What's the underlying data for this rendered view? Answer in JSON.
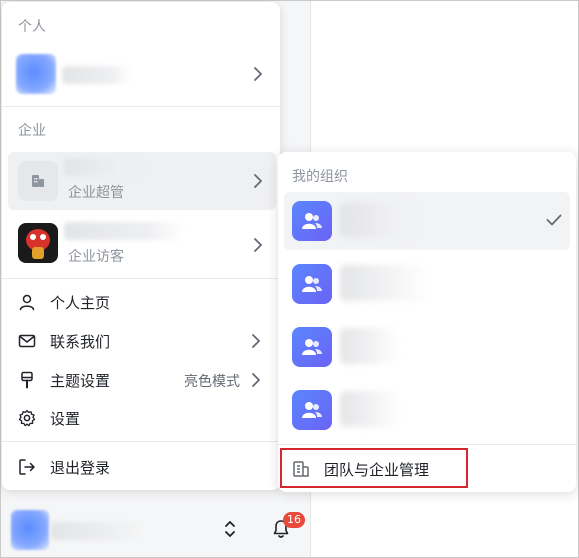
{
  "menu": {
    "personal_section": "个人",
    "enterprise_section": "企业",
    "enterprises": [
      {
        "role": "企业超管",
        "selected": true
      },
      {
        "role": "企业访客",
        "selected": false
      }
    ],
    "items": [
      {
        "label": "个人主页",
        "icon": "user-icon"
      },
      {
        "label": "联系我们",
        "icon": "mail-icon"
      },
      {
        "label": "主题设置",
        "icon": "brush-icon",
        "value": "亮色模式"
      },
      {
        "label": "设置",
        "icon": "gear-icon"
      }
    ],
    "logout_label": "退出登录"
  },
  "org_panel": {
    "title": "我的组织",
    "organizations": [
      {
        "selected": true,
        "icon": "team-icon"
      },
      {
        "selected": false,
        "icon": "team-icon"
      },
      {
        "selected": false,
        "icon": "team-icon"
      },
      {
        "selected": false,
        "icon": "team-icon"
      }
    ],
    "manage_label": "团队与企业管理"
  },
  "bottom_bar": {
    "notification_count": "16"
  },
  "colors": {
    "accent": "#5a86ff",
    "highlight_border": "#d6262f",
    "badge": "#e84a3b"
  }
}
